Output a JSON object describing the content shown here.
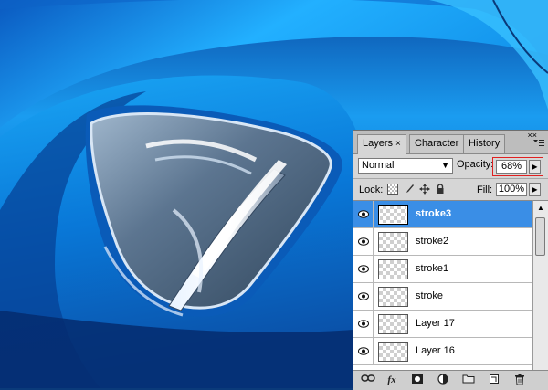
{
  "panel": {
    "tabs": [
      {
        "label": "Layers",
        "close": "×",
        "active": true
      },
      {
        "label": "Character",
        "active": false
      },
      {
        "label": "History",
        "active": false
      }
    ],
    "menu_icon": "panel-menu-icon",
    "close_glyph": "××",
    "blend_mode": "Normal",
    "opacity_label": "Opacity:",
    "opacity_value": "68%",
    "lock_label": "Lock:",
    "fill_label": "Fill:",
    "fill_value": "100%",
    "layers": [
      {
        "name": "stroke3",
        "selected": true
      },
      {
        "name": "stroke2",
        "selected": false
      },
      {
        "name": "stroke1",
        "selected": false
      },
      {
        "name": "stroke",
        "selected": false
      },
      {
        "name": "Layer 17",
        "selected": false
      },
      {
        "name": "Layer 16",
        "selected": false
      }
    ],
    "bottom_icons": [
      "link-icon",
      "fx-icon",
      "mask-icon",
      "adjustment-icon",
      "folder-icon",
      "new-layer-icon",
      "trash-icon"
    ],
    "fx_label": "fx"
  },
  "colors": {
    "selection": "#3a8ee6",
    "highlight_box": "#e02020",
    "car_body": "#0a7fd8"
  }
}
